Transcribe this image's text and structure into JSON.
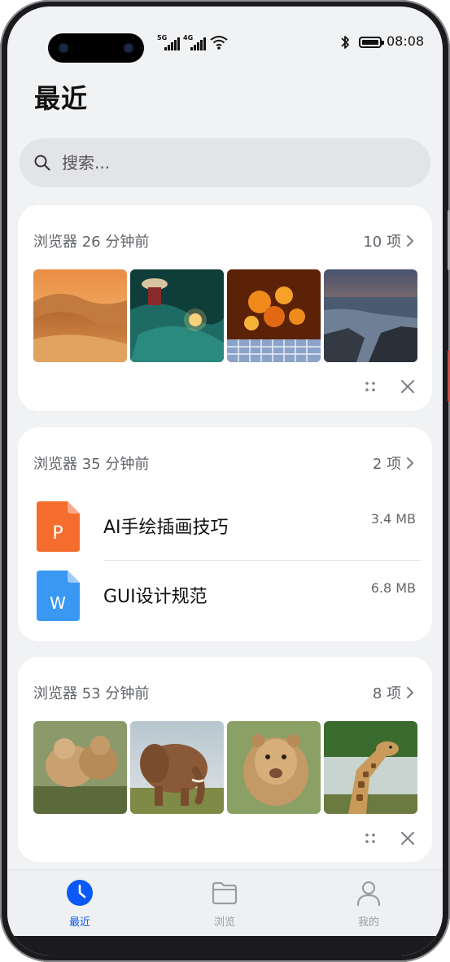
{
  "status_bar": {
    "signal1_label": "5G",
    "signal2_label": "4G",
    "time": "08:08"
  },
  "page": {
    "title": "最近"
  },
  "search": {
    "placeholder": "搜索..."
  },
  "cards": [
    {
      "header": "浏览器 26 分钟前",
      "count": "10 项",
      "thumbnails": [
        "desert-dunes-sunset",
        "fisherman-with-green-net",
        "orange-flowers-on-tiles",
        "rocky-coast-at-dusk"
      ]
    },
    {
      "header": "浏览器 35 分钟前",
      "count": "2 项",
      "files": [
        {
          "icon_letter": "P",
          "icon": "ppt-file-icon",
          "name": "AI手绘插画技巧",
          "size": "3.4 MB",
          "color": "#f56d2c"
        },
        {
          "icon_letter": "W",
          "icon": "word-file-icon",
          "name": "GUI设计规范",
          "size": "6.8 MB",
          "color": "#3a98f5"
        }
      ]
    },
    {
      "header": "浏览器 53 分钟前",
      "count": "8 项",
      "thumbnails": [
        "lion-cubs",
        "elephant",
        "lioness",
        "giraffe"
      ]
    }
  ],
  "tab_bar": {
    "active_color": "#0a59f7",
    "tabs": [
      {
        "label": "最近",
        "icon": "clock-icon",
        "active": true
      },
      {
        "label": "浏览",
        "icon": "folder-icon",
        "active": false
      },
      {
        "label": "我的",
        "icon": "person-icon",
        "active": false
      }
    ]
  }
}
